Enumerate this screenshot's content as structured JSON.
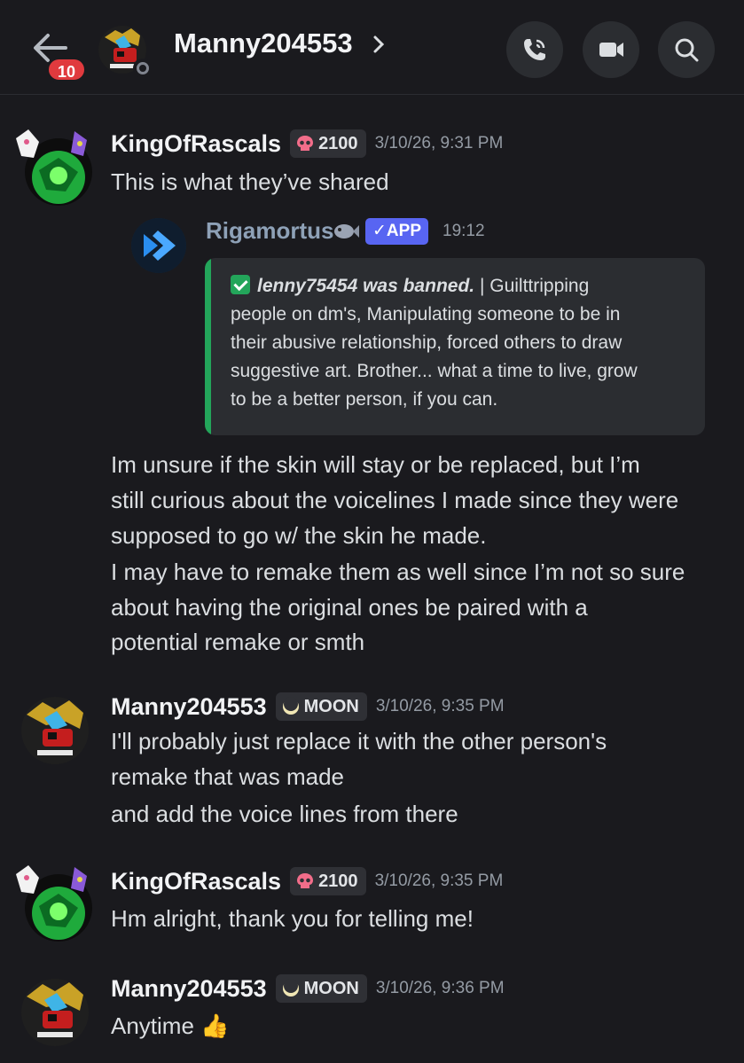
{
  "header": {
    "back_badge": "10",
    "title": "Manny204553"
  },
  "messages": [
    {
      "username": "KingOfRascals",
      "tag_text": "2100",
      "tag_icon": "skull-icon",
      "timestamp": "3/10/26, 9:31 PM",
      "lines": [
        "This is what they’ve shared"
      ]
    },
    {
      "username": "Manny204553",
      "tag_text": "MOON",
      "tag_icon": "moon-icon",
      "timestamp": "3/10/26, 9:35 PM",
      "lines": [
        "I'll probably just replace it with the other person's",
        "remake that was made",
        "and add the voice lines from there"
      ]
    },
    {
      "username": "KingOfRascals",
      "tag_text": "2100",
      "tag_icon": "skull-icon",
      "timestamp": "3/10/26, 9:35 PM",
      "lines": [
        "Hm alright, thank you for telling me!"
      ]
    },
    {
      "username": "Manny204553",
      "tag_text": "MOON",
      "tag_icon": "moon-icon",
      "timestamp": "3/10/26, 9:36 PM",
      "lines": [
        "Anytime 👍"
      ]
    }
  ],
  "forwarded": {
    "bot_name": "Rigamortus",
    "app_label": "✓APP",
    "time": "19:12",
    "embed_bold": "lenny75454 was banned.",
    "embed_lines": [
      " | Guilttripping",
      "people on dm's, Manipulating someone to be in",
      "their abusive relationship, forced others to draw",
      "suggestive art. Brother... what a time to live, grow",
      "to be a better person, if you can."
    ]
  },
  "continuation": [
    "Im unsure if the skin will stay or be replaced, but I’m",
    "still curious about the voicelines I made since they were",
    "supposed to go w/ the skin he made.",
    "I may have to remake them as well since I’m not so sure",
    "about having the original ones be paired with a",
    "potential remake or smth"
  ],
  "colors": {
    "background": "#1a1a1e",
    "embed_accent": "#23a55a",
    "app_tag": "#5865f2",
    "badge": "#e03a3e"
  }
}
